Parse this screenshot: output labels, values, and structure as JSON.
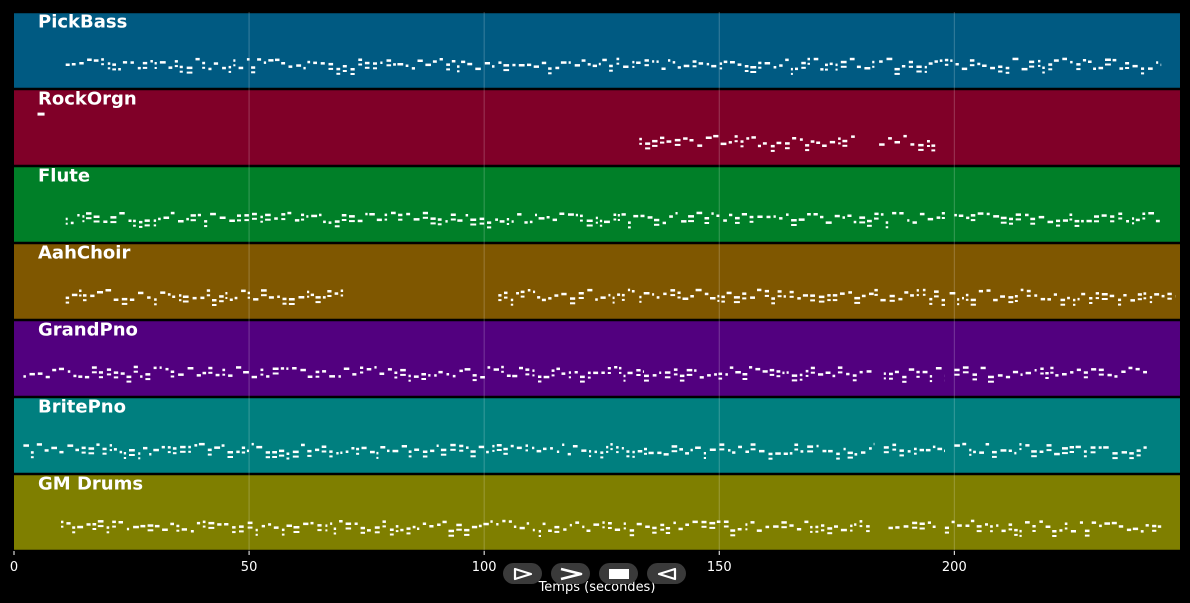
{
  "chart_data": {
    "type": "piano-roll",
    "xlabel": "Temps (secondes)",
    "xlim": [
      0,
      248
    ],
    "x_ticks": [
      0,
      50,
      100,
      150,
      200
    ],
    "grid": true,
    "tracks": [
      {
        "name": "PickBass",
        "color": "#005a82",
        "active": [
          [
            11,
            183
          ],
          [
            184,
            198
          ],
          [
            198,
            244
          ]
        ]
      },
      {
        "name": "RockOrgn",
        "color": "#800028",
        "active": [
          [
            5,
            6.5
          ],
          [
            133,
            179
          ],
          [
            184,
            196
          ]
        ]
      },
      {
        "name": "Flute",
        "color": "#007f28",
        "active": [
          [
            11,
            183
          ],
          [
            183,
            198
          ],
          [
            200,
            244
          ]
        ]
      },
      {
        "name": "AahChoir",
        "color": "#7f5700",
        "active": [
          [
            11,
            70
          ],
          [
            103,
            132
          ],
          [
            133,
            183
          ],
          [
            183,
            198
          ],
          [
            199,
            247
          ]
        ]
      },
      {
        "name": "GrandPno",
        "color": "#52007f",
        "active": [
          [
            2,
            134
          ],
          [
            134,
            183
          ],
          [
            185,
            198
          ],
          [
            200,
            241
          ]
        ]
      },
      {
        "name": "BritePno",
        "color": "#007f7f",
        "active": [
          [
            2,
            134
          ],
          [
            134,
            183
          ],
          [
            185,
            198
          ],
          [
            200,
            241
          ]
        ]
      },
      {
        "name": "GM Drums",
        "color": "#7f7f00",
        "active": [
          [
            10,
            182
          ],
          [
            186,
            196
          ],
          [
            198,
            244
          ]
        ]
      }
    ]
  },
  "controls": {
    "play": "play-icon",
    "forward": "fast-forward-icon",
    "stop": "stop-icon",
    "rewind": "rewind-icon"
  }
}
